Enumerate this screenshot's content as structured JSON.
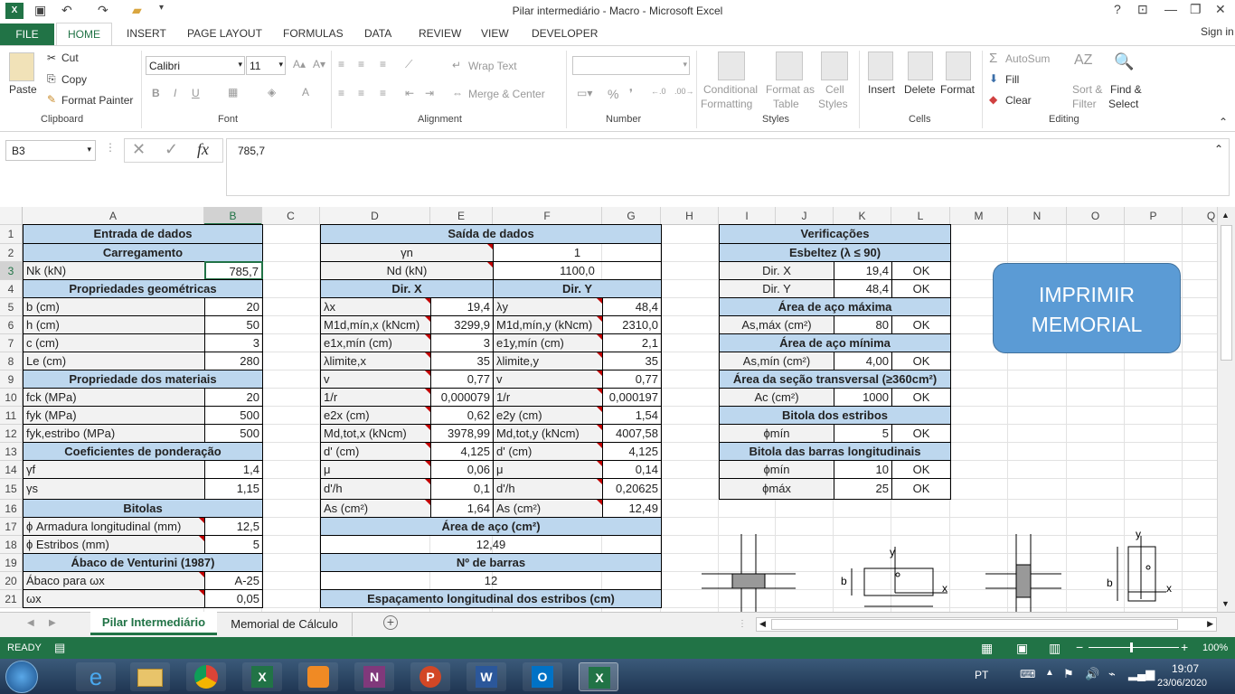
{
  "window": {
    "title": "Pilar intermediário - Macro - Microsoft Excel",
    "sign_in": "Sign in",
    "help": "?"
  },
  "ribbon_tabs": [
    "FILE",
    "HOME",
    "INSERT",
    "PAGE LAYOUT",
    "FORMULAS",
    "DATA",
    "REVIEW",
    "VIEW",
    "DEVELOPER"
  ],
  "clipboard": {
    "paste": "Paste",
    "cut": "Cut",
    "copy": "Copy",
    "format_painter": "Format Painter",
    "label": "Clipboard"
  },
  "font": {
    "name": "Calibri",
    "size": "11",
    "label": "Font",
    "bold": "B",
    "italic": "I",
    "underline": "U"
  },
  "alignment": {
    "wrap": "Wrap Text",
    "merge": "Merge & Center",
    "label": "Alignment"
  },
  "number": {
    "label": "Number",
    "percent": "%"
  },
  "styles": {
    "cond": "Conditional",
    "cond2": "Formatting",
    "fmt": "Format as",
    "fmt2": "Table",
    "cell": "Cell",
    "cell2": "Styles",
    "label": "Styles"
  },
  "cells": {
    "insert": "Insert",
    "delete": "Delete",
    "format": "Format",
    "label": "Cells"
  },
  "editing": {
    "autosum": "AutoSum",
    "fill": "Fill",
    "clear": "Clear",
    "sort": "Sort &",
    "sort2": "Filter",
    "find": "Find &",
    "find2": "Select",
    "label": "Editing"
  },
  "formula_bar": {
    "name_box": "B3",
    "value": "785,7",
    "fx": "fx"
  },
  "columns": [
    "A",
    "B",
    "C",
    "D",
    "E",
    "F",
    "G",
    "H",
    "I",
    "J",
    "K",
    "L",
    "M",
    "N",
    "O",
    "P",
    "Q"
  ],
  "rows": [
    "1",
    "2",
    "3",
    "4",
    "5",
    "6",
    "7",
    "8",
    "9",
    "10",
    "11",
    "12",
    "13",
    "14",
    "15",
    "16",
    "17",
    "18",
    "19",
    "20",
    "21"
  ],
  "entrada": {
    "title": "Entrada de dados",
    "carregamento": "Carregamento",
    "nk": "Nk (kN)",
    "nk_val": "785,7",
    "prop_geo": "Propriedades geométricas",
    "b": "b (cm)",
    "b_val": "20",
    "h": "h (cm)",
    "h_val": "50",
    "c": "c (cm)",
    "c_val": "3",
    "le": "Le (cm)",
    "le_val": "280",
    "prop_mat": "Propriedade dos materiais",
    "fck": "fck (MPa)",
    "fck_val": "20",
    "fyk": "fyk (MPa)",
    "fyk_val": "500",
    "fyke": "fyk,estribo (MPa)",
    "fyke_val": "500",
    "coef": "Coeficientes de ponderação",
    "gf": "γf",
    "gf_val": "1,4",
    "gs": "γs",
    "gs_val": "1,15",
    "bitolas": "Bitolas",
    "phil": "ϕ Armadura longitudinal (mm)",
    "phil_val": "12,5",
    "phie": "ϕ Estribos (mm)",
    "phie_val": "5",
    "abaco": "Ábaco de Venturini (1987)",
    "abaco_w": "Ábaco para ωx",
    "abaco_w_val": "A-25",
    "wx": "ωx",
    "wx_val": "0,05"
  },
  "saida": {
    "title": "Saída de dados",
    "gn": "γn",
    "gn_val": "1",
    "nd": "Nd (kN)",
    "nd_val": "1100,0",
    "dirx": "Dir. X",
    "diry": "Dir. Y",
    "lx": "λx",
    "lx_val": "19,4",
    "ly": "λy",
    "ly_val": "48,4",
    "m1x": "M1d,mín,x (kNcm)",
    "m1x_val": "3299,9",
    "m1y": "M1d,mín,y (kNcm)",
    "m1y_val": "2310,0",
    "e1x": "e1x,mín (cm)",
    "e1x_val": "3",
    "e1y": "e1y,mín (cm)",
    "e1y_val": "2,1",
    "llx": "λlimite,x",
    "llx_val": "35",
    "lly": "λlimite,y",
    "lly_val": "35",
    "v": "v",
    "v_val": "0,77",
    "v2": "v",
    "v2_val": "0,77",
    "r1": "1/r",
    "r1_val": "0,000079",
    "r2": "1/r",
    "r2_val": "0,000197",
    "e2x": "e2x (cm)",
    "e2x_val": "0,62",
    "e2y": "e2y (cm)",
    "e2y_val": "1,54",
    "mdx": "Md,tot,x (kNcm)",
    "mdx_val": "3978,99",
    "mdy": "Md,tot,y (kNcm)",
    "mdy_val": "4007,58",
    "d1": "d' (cm)",
    "d1_val": "4,125",
    "d2": "d' (cm)",
    "d2_val": "4,125",
    "mu1": "μ",
    "mu1_val": "0,06",
    "mu2": "μ",
    "mu2_val": "0,14",
    "dh1": "d'/h",
    "dh1_val": "0,1",
    "dh2": "d'/h",
    "dh2_val": "0,20625",
    "as1": "As (cm²)",
    "as1_val": "1,64",
    "as2": "As (cm²)",
    "as2_val": "12,49",
    "area": "Área de aço (cm²)",
    "area_val": "12,49",
    "nbar": "Nº de barras",
    "nbar_val": "12",
    "esp": "Espaçamento longitudinal dos estribos (cm)"
  },
  "verif": {
    "title": "Verificações",
    "esbeltez": "Esbeltez (λ ≤ 90)",
    "dx": "Dir. X",
    "dx_val": "19,4",
    "dx_ok": "OK",
    "dy": "Dir. Y",
    "dy_val": "48,4",
    "dy_ok": "OK",
    "amax": "Área de aço máxima",
    "asmax": "As,máx (cm²)",
    "asmax_val": "80",
    "asmax_ok": "OK",
    "amin": "Área de aço mínima",
    "asmin": "As,mín (cm²)",
    "asmin_val": "4,00",
    "asmin_ok": "OK",
    "asec": "Área da seção transversal (≥360cm²)",
    "ac": "Ac (cm²)",
    "ac_val": "1000",
    "ac_ok": "OK",
    "best": "Bitola dos estribos",
    "phimin": "ϕmín",
    "phimin_val": "5",
    "phimin_ok": "OK",
    "blong": "Bitola das barras longitudinais",
    "pmin": "ϕmín",
    "pmin_val": "10",
    "pmin_ok": "OK",
    "pmax": "ϕmáx",
    "pmax_val": "25",
    "pmax_ok": "OK"
  },
  "button": {
    "line1": "IMPRIMIR",
    "line2": "MEMORIAL"
  },
  "sheets": [
    "Pilar Intermediário",
    "Memorial de Cálculo"
  ],
  "status": {
    "ready": "READY",
    "zoom": "100%"
  },
  "taskbar": {
    "lang": "PT",
    "time": "19:07",
    "date": "23/06/2020"
  },
  "diagram": {
    "b1": "b",
    "x1": "x",
    "y1": "y",
    "b2": "b",
    "x2": "x",
    "y2": "y"
  },
  "colors": {
    "excel_green": "#217346",
    "header_blue": "#bdd7ee",
    "button_blue": "#5b9bd5"
  }
}
